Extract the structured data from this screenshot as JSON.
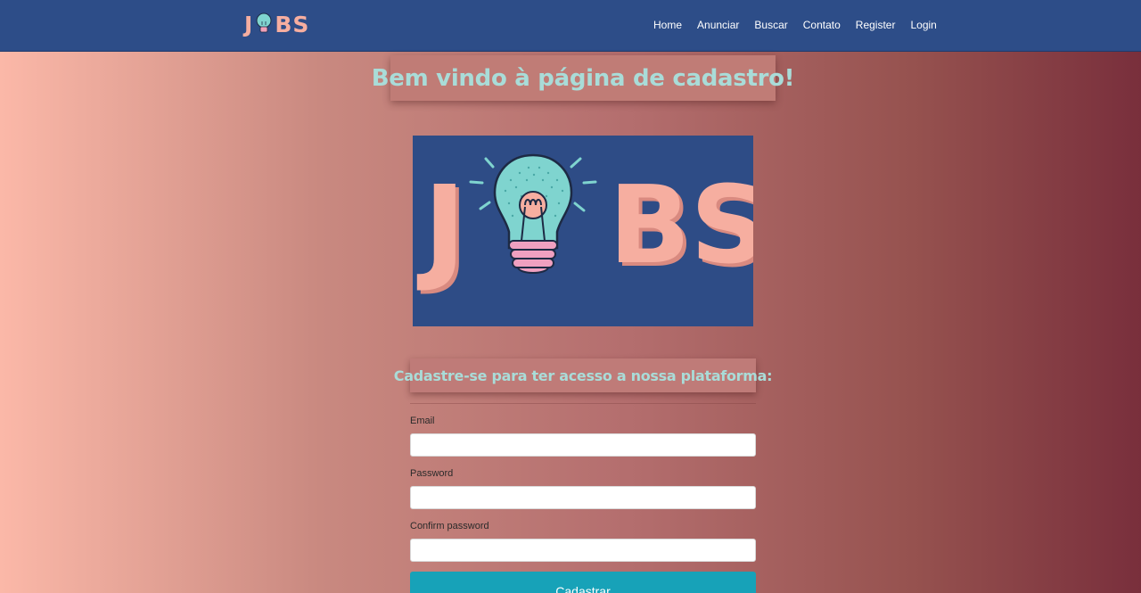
{
  "navbar": {
    "brand_left": "J",
    "brand_right": "BS",
    "links": [
      {
        "label": "Home"
      },
      {
        "label": "Anunciar"
      },
      {
        "label": "Buscar"
      },
      {
        "label": "Contato"
      },
      {
        "label": "Register"
      },
      {
        "label": "Login"
      }
    ]
  },
  "page": {
    "title": "Bem vindo à página de cadastro!",
    "subtitle": "Cadastre-se para ter acesso a nossa plataforma:"
  },
  "logo": {
    "left": "J",
    "right": "BS"
  },
  "form": {
    "email_label": "Email",
    "email_value": "",
    "password_label": "Password",
    "password_value": "",
    "confirm_label": "Confirm password",
    "confirm_value": "",
    "submit_label": "Cadastrar"
  },
  "icons": {
    "bulb": "lightbulb-icon"
  },
  "colors": {
    "navbar": "#2d4d88",
    "accent_text": "#a9dcd8",
    "logo_pink": "#f6aea0",
    "button": "#17a2b8"
  }
}
